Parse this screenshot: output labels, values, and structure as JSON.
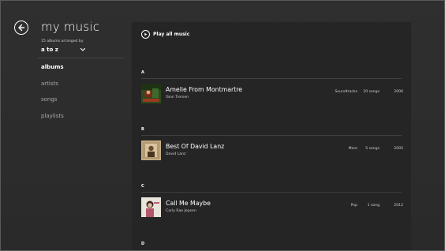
{
  "header": {
    "title": "my music"
  },
  "sort": {
    "caption": "15 albums arranged by",
    "value": "a to z"
  },
  "nav": {
    "items": [
      {
        "label": "albums",
        "active": true
      },
      {
        "label": "artists",
        "active": false
      },
      {
        "label": "songs",
        "active": false
      },
      {
        "label": "playlists",
        "active": false
      }
    ]
  },
  "content": {
    "play_all_label": "Play all music",
    "groups": [
      {
        "letter": "A",
        "album": {
          "title": "Amelie From Montmartre",
          "artist": "Yann Tiersen",
          "genre": "Soundtracks",
          "songs": "20 songs",
          "year": "2006"
        }
      },
      {
        "letter": "B",
        "album": {
          "title": "Best Of David Lanz",
          "artist": "David Lanz",
          "genre": "More",
          "songs": "5 songs",
          "year": "2005"
        }
      },
      {
        "letter": "C",
        "album": {
          "title": "Call Me Maybe",
          "artist": "Carly Rae Jepsen",
          "genre": "Pop",
          "songs": "1 song",
          "year": "2012"
        }
      },
      {
        "letter": "D"
      }
    ]
  },
  "colors": {
    "background": "#2d2d2d",
    "content_panel": "#252525",
    "text_primary": "#ffffff",
    "text_secondary": "#cfcfcf",
    "nav_inactive": "#a8a8a8"
  },
  "icons": {
    "back": "back-arrow-icon",
    "sort": "chevron-down-icon",
    "play": "play-icon"
  }
}
